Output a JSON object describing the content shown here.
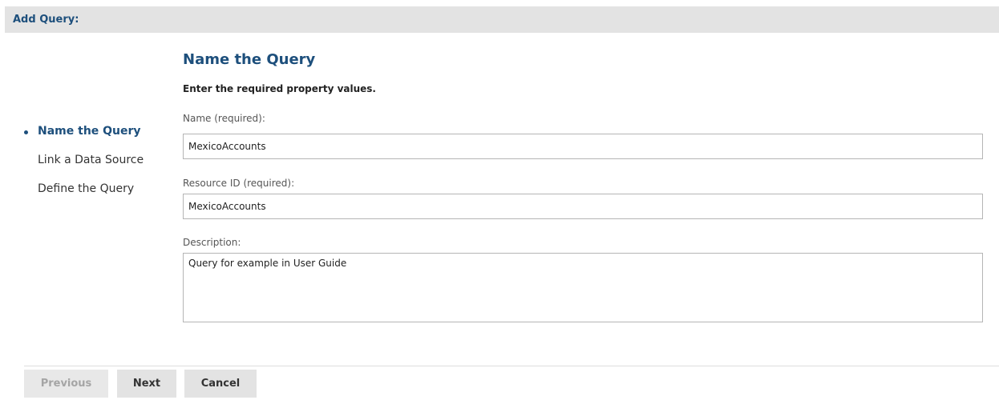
{
  "header": {
    "title": "Add Query:"
  },
  "steps": [
    {
      "label": "Name the Query",
      "active": true
    },
    {
      "label": "Link a Data Source",
      "active": false
    },
    {
      "label": "Define the Query",
      "active": false
    }
  ],
  "main": {
    "title": "Name the Query",
    "instructions": "Enter the required property values.",
    "fields": {
      "name": {
        "label": "Name (required):",
        "value": "MexicoAccounts"
      },
      "resource_id": {
        "label": "Resource ID (required):",
        "value": "MexicoAccounts"
      },
      "description": {
        "label": "Description:",
        "value": "Query for example in User Guide"
      }
    }
  },
  "buttons": {
    "previous": "Previous",
    "next": "Next",
    "cancel": "Cancel"
  },
  "colors": {
    "accent": "#1d4f7c",
    "header_bg": "#e3e3e3"
  }
}
